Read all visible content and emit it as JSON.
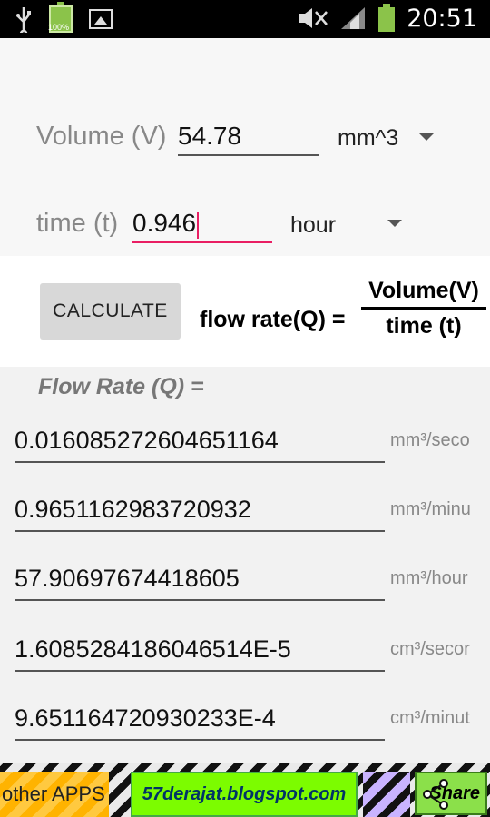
{
  "status_bar": {
    "battery_small_label": "100%",
    "time": "20:51"
  },
  "inputs": {
    "volume_label": "Volume (V)",
    "volume_value": "54.78",
    "volume_unit": "mm^3",
    "time_label": "time (t)",
    "time_value": "0.946",
    "time_unit": "hour"
  },
  "calc": {
    "button_label": "CALCULATE",
    "formula_lhs": "flow rate(Q) =",
    "formula_numerator": "Volume(V)",
    "formula_denominator": "time (t)"
  },
  "results": {
    "title": "Flow Rate (Q) =",
    "rows": [
      {
        "value": "0.016085272604651164",
        "unit": "mm³/seco"
      },
      {
        "value": "0.9651162983720932",
        "unit": "mm³/minu"
      },
      {
        "value": "57.90697674418605",
        "unit": "mm³/hour"
      },
      {
        "value": "1.6085284186046514E-5",
        "unit": "cm³/secor"
      },
      {
        "value": "9.651164720930233E-4",
        "unit": "cm³/minut"
      }
    ]
  },
  "footer": {
    "other_apps": "other APPS",
    "blog": "57derajat.blogspot.com",
    "share": "Share"
  },
  "colors": {
    "accent_pink": "#e91e63",
    "blog_green": "#7cfc00",
    "share_green": "#8be04a",
    "other_apps_orange": "#ffb300"
  }
}
